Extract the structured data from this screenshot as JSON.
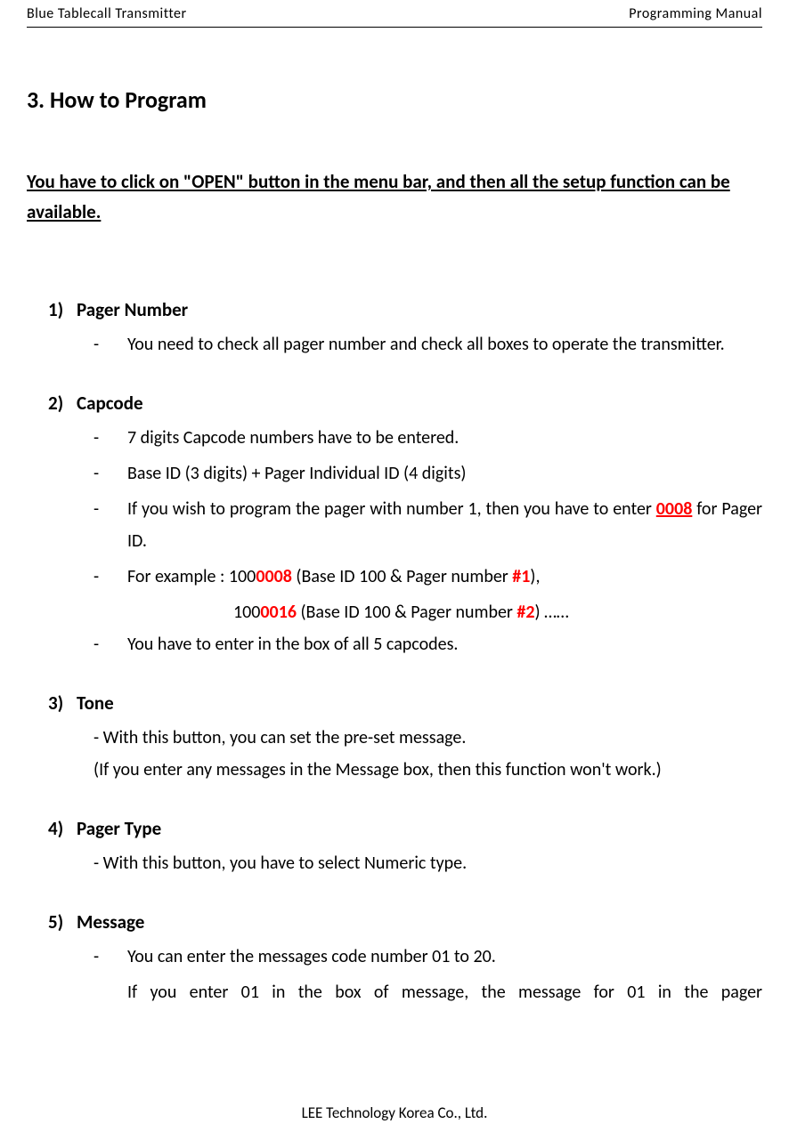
{
  "header": {
    "left": "Blue Tablecall Transmitter",
    "right": "Programming Manual"
  },
  "title": "3. How to Program",
  "intro": "You have to click on \"OPEN\" button in the menu bar, and then all the setup function can be available.",
  "sections": {
    "s1": {
      "num": "1)",
      "title": "Pager Number",
      "b1_dash": "-",
      "b1_text": "You need to check all pager number and check all boxes to operate the transmitter."
    },
    "s2": {
      "num": "2)",
      "title": "Capcode",
      "b1_dash": "-",
      "b1_text": "7 digits Capcode numbers have to be entered.",
      "b2_dash": "-",
      "b2_text": "Base ID (3 digits) + Pager Individual ID (4 digits)",
      "b3_dash": "-",
      "b3_pre": "If you wish to program the pager with number 1, then you have to enter ",
      "b3_red": "0008",
      "b3_post": " for Pager ID.",
      "b4_dash": "-",
      "b4_pre": "For example : 100",
      "b4_red1": "0008",
      "b4_mid1": " (Base ID 100 & Pager number ",
      "b4_red2": "#1",
      "b4_end1": "),",
      "b4b_pre": "100",
      "b4b_red": "0016",
      "b4b_mid": " (Base ID 100 & Pager number ",
      "b4b_red2": "#2",
      "b4b_end": ") ……",
      "b5_dash": "-",
      "b5_text": "You have to enter in the box of all 5 capcodes."
    },
    "s3": {
      "num": "3)",
      "title": "Tone",
      "line1": "- With this button, you can set the pre-set message.",
      "line2": "(If you enter any messages in the Message box, then this function won't work.)"
    },
    "s4": {
      "num": "4)",
      "title": "Pager Type",
      "line1": "- With this button, you have to select Numeric type."
    },
    "s5": {
      "num": "5)",
      "title": "Message",
      "b1_dash": "-",
      "b1_text": "You can enter the messages code number 01 to 20.",
      "b2_text": "If you enter 01 in the box of message, the message for 01 in the pager"
    }
  },
  "footer": "LEE Technology Korea Co., Ltd."
}
